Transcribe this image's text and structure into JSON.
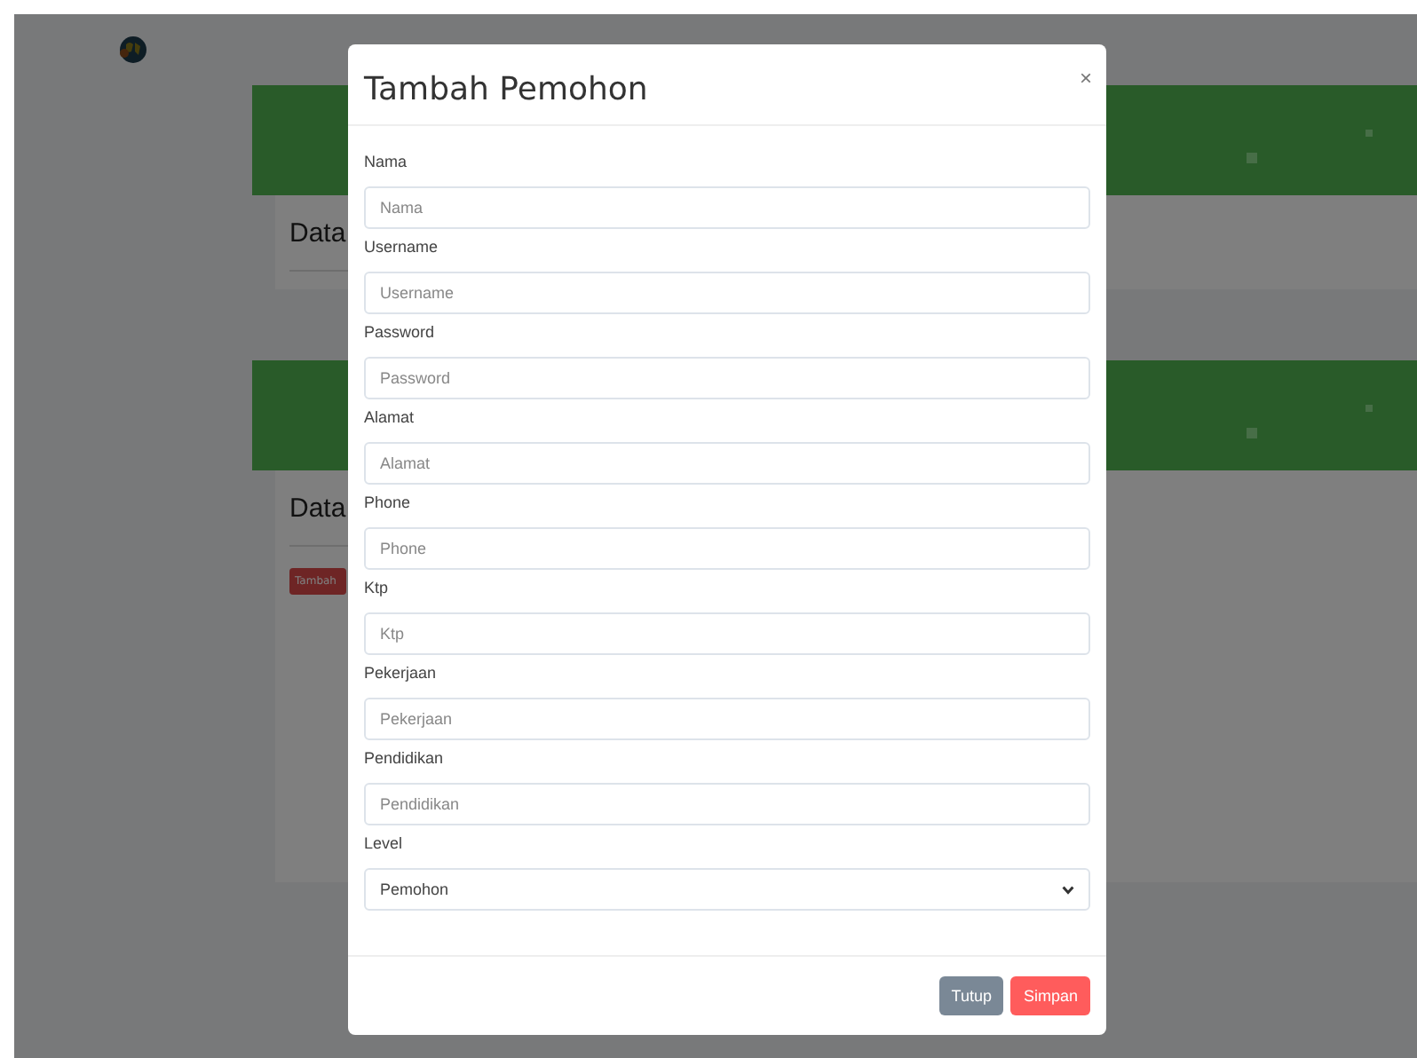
{
  "background": {
    "sections": [
      {
        "title": "Data"
      },
      {
        "title": "Data",
        "button": "Tambah"
      }
    ]
  },
  "modal": {
    "title": "Tambah Pemohon",
    "close": "×",
    "fields": [
      {
        "kind": "input",
        "label": "Nama",
        "placeholder": "Nama"
      },
      {
        "kind": "input",
        "label": "Username",
        "placeholder": "Username"
      },
      {
        "kind": "input",
        "label": "Password",
        "placeholder": "Password"
      },
      {
        "kind": "input",
        "label": "Alamat",
        "placeholder": "Alamat"
      },
      {
        "kind": "input",
        "label": "Phone",
        "placeholder": "Phone"
      },
      {
        "kind": "input",
        "label": "Ktp",
        "placeholder": "Ktp"
      },
      {
        "kind": "input",
        "label": "Pekerjaan",
        "placeholder": "Pekerjaan"
      },
      {
        "kind": "input",
        "label": "Pendidikan",
        "placeholder": "Pendidikan"
      },
      {
        "kind": "select",
        "label": "Level",
        "value": "Pemohon"
      }
    ],
    "buttons": [
      {
        "label": "Tutup",
        "kind": "secondary"
      },
      {
        "label": "Simpan",
        "kind": "primary"
      }
    ]
  }
}
